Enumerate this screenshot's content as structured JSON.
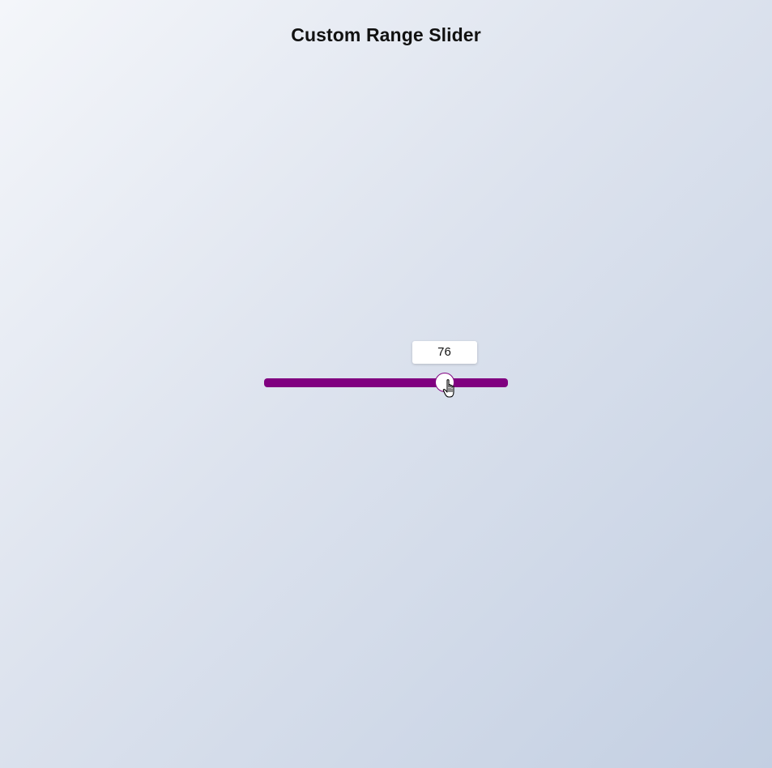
{
  "page": {
    "title": "Custom Range Slider"
  },
  "slider": {
    "value": 76,
    "value_label": "76",
    "min": 0,
    "max": 100,
    "track_color": "#800080",
    "thumb_color": "#ffffff"
  },
  "icons": {
    "cursor": "hand-pointer-icon"
  }
}
